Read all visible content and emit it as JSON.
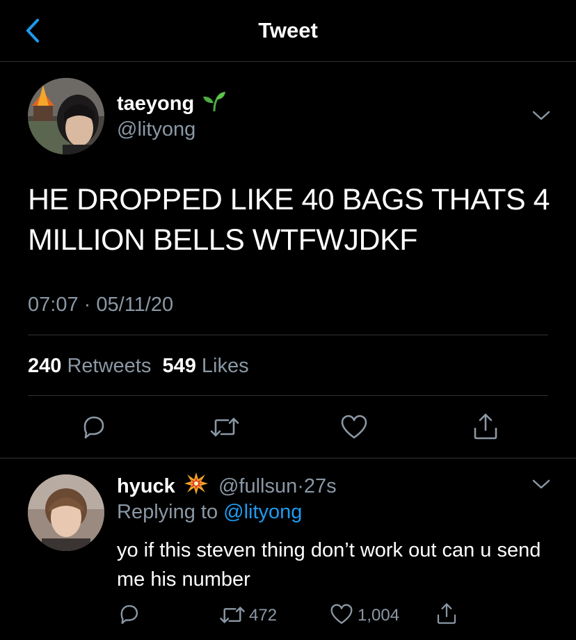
{
  "header": {
    "title": "Tweet",
    "back_icon": "chevron-left-icon"
  },
  "tweet": {
    "author": {
      "display_name": "taeyong",
      "name_emoji": "seedling",
      "handle": "@lityong"
    },
    "text": "HE DROPPED LIKE 40 BAGS THATS 4 MILLION BELLS WTFWJDKF",
    "time": "07:07",
    "separator": "·",
    "date": "05/11/20",
    "retweets_count": "240",
    "retweets_label": "Retweets",
    "likes_count": "549",
    "likes_label": "Likes",
    "actions": [
      "reply-icon",
      "retweet-icon",
      "like-icon",
      "share-icon"
    ]
  },
  "reply": {
    "author": {
      "display_name": "hyuck",
      "name_emoji": "collision",
      "handle": "@fullsun",
      "age": "27s"
    },
    "replying_prefix": "Replying to",
    "replying_to": "@lityong",
    "text": "yo if this steven thing don’t work out can u send me his number",
    "retweets": "472",
    "likes": "1,004"
  },
  "colors": {
    "background": "#000000",
    "text": "#ffffff",
    "secondary": "#8b98a5",
    "accent": "#1d9bf0",
    "divider": "#2f3336"
  }
}
